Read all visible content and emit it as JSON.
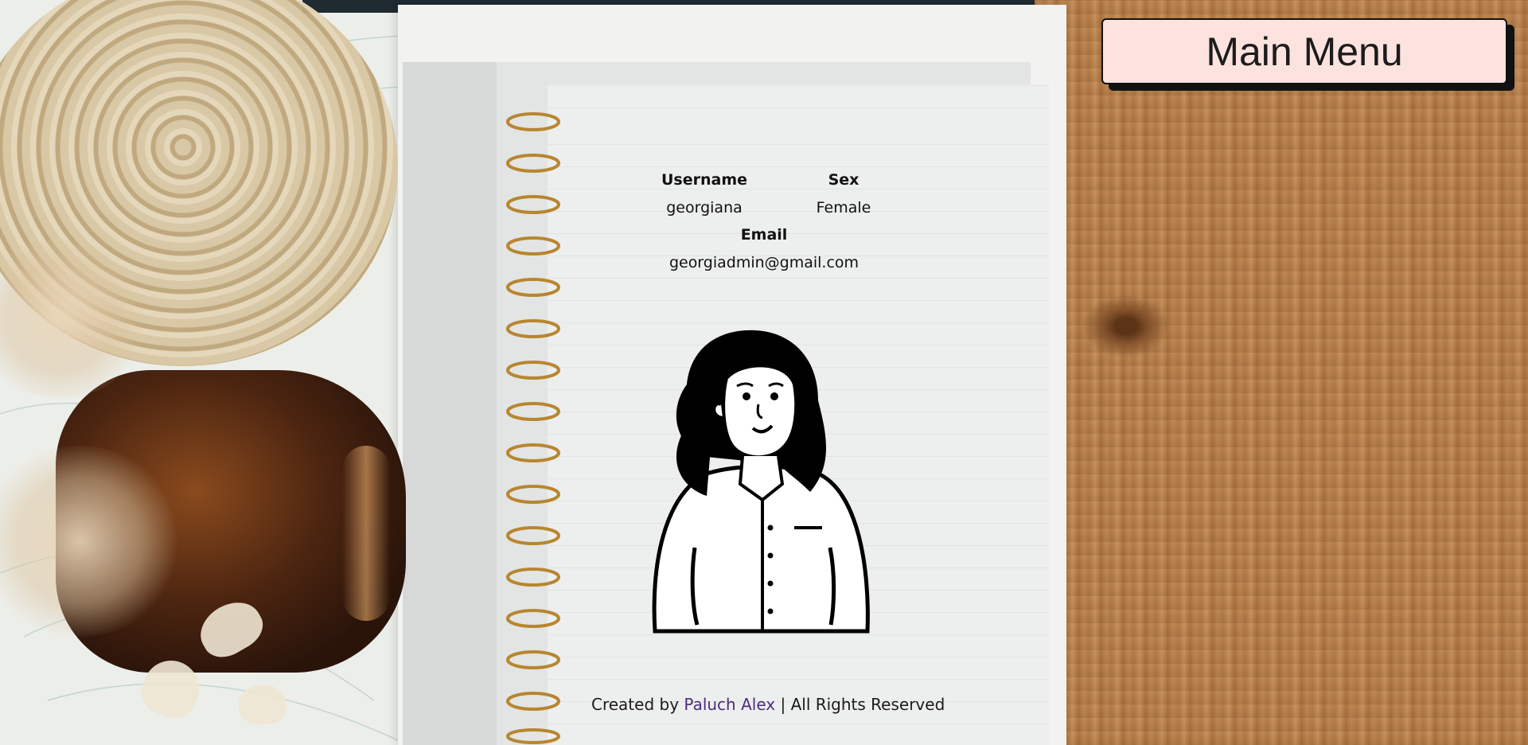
{
  "header": {
    "main_menu_label": "Main Menu"
  },
  "profile": {
    "username_label": "Username",
    "username_value": "georgiana",
    "sex_label": "Sex",
    "sex_value": "Female",
    "email_label": "Email",
    "email_value": "georgiadmin@gmail.com"
  },
  "footer": {
    "prefix": "Created by",
    "author": "Paluch Alex",
    "suffix": "| All Rights Reserved"
  },
  "colors": {
    "button_bg": "#fde3df",
    "author_link": "#4b2f7a",
    "page": "#edeeee",
    "wood": "#b07c4e"
  }
}
